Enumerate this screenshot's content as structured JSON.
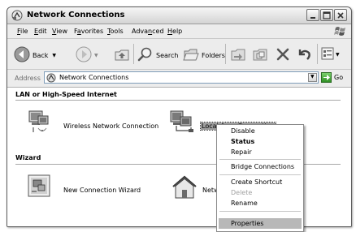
{
  "window": {
    "title": "Network Connections",
    "controls": [
      "minimize",
      "maximize",
      "close"
    ]
  },
  "menu": {
    "items": [
      {
        "label": "File",
        "hotkey": "F"
      },
      {
        "label": "Edit",
        "hotkey": "E"
      },
      {
        "label": "View",
        "hotkey": "V"
      },
      {
        "label": "Favorites",
        "hotkey": "a"
      },
      {
        "label": "Tools",
        "hotkey": "T"
      },
      {
        "label": "Advanced",
        "hotkey": "n"
      },
      {
        "label": "Help",
        "hotkey": "H"
      }
    ]
  },
  "toolbar": {
    "back_label": "Back",
    "search_label": "Search",
    "folders_label": "Folders"
  },
  "address": {
    "label": "Address",
    "value": "Network Connections",
    "go_label": "Go"
  },
  "content": {
    "group1_title": "LAN or High-Speed Internet",
    "group2_title": "Wizard",
    "items": [
      {
        "label": "Wireless Network Connection",
        "icon": "wireless-network-icon"
      },
      {
        "label": "Local Area Connection",
        "icon": "lan-connection-icon",
        "selected": true
      },
      {
        "label": "New Connection Wizard",
        "icon": "wizard-icon"
      },
      {
        "label": "Netw",
        "icon": "home-network-icon"
      }
    ]
  },
  "context_menu": {
    "disable": "Disable",
    "status": "Status",
    "repair": "Repair",
    "bridge": "Bridge Connections",
    "create_shortcut": "Create Shortcut",
    "delete": "Delete",
    "rename": "Rename",
    "properties": "Properties",
    "highlighted": "Properties"
  },
  "colors": {
    "selection": "#9e9e9e",
    "menu_highlight": "#b8b8b8",
    "disabled_text": "#a0a0a0"
  }
}
